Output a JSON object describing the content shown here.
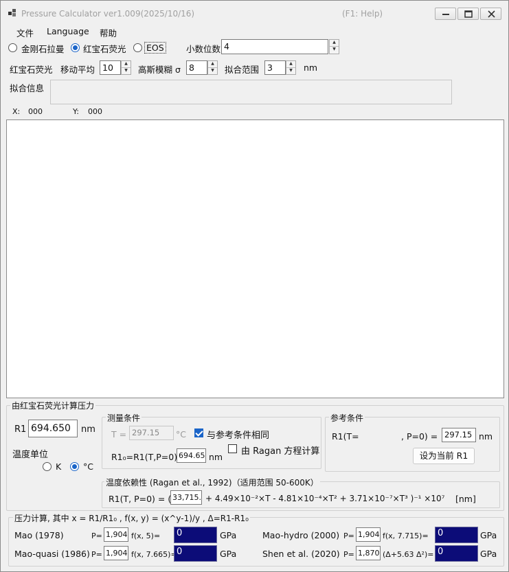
{
  "window": {
    "title": "Pressure Calculator  ver1.009(2025/10/16)",
    "help_hint": "(F1: Help)"
  },
  "menu": [
    "文件",
    "Language",
    "帮助"
  ],
  "mode": {
    "options": [
      "金刚石拉曼",
      "红宝石荧光",
      "EOS"
    ],
    "selected": "红宝石荧光",
    "decimals_label": "小数位数",
    "decimals_value": "4"
  },
  "fit": {
    "section_label": "红宝石荧光",
    "moving_avg_label": "移动平均",
    "moving_avg_value": "10",
    "gauss_label": "高斯模糊 σ",
    "gauss_value": "8",
    "range_label": "拟合范围",
    "range_value": "3",
    "range_unit": "nm",
    "info_label": "拟合信息",
    "info_value": ""
  },
  "cursor": {
    "x_label": "X:",
    "x_value": "000",
    "y_label": "Y:",
    "y_value": "000"
  },
  "ruby": {
    "group_title": "由红宝石荧光计算压力",
    "r1_label": "R1",
    "r1_value": "694.650",
    "r1_unit": "nm",
    "temp_unit_label": "温度单位",
    "temp_units": [
      "K",
      "°C"
    ],
    "temp_unit_selected": "°C",
    "measure": {
      "title": "测量条件",
      "t_label": "T =",
      "t_value": "297.15",
      "t_unit": "°C",
      "same_as_ref_label": "与参考条件相同",
      "same_as_ref_checked": true,
      "r10_label": "R1₀=R1(T,P=0)",
      "r10_value": "694.650",
      "r10_unit": "nm",
      "ragan_label": "由 Ragan 方程计算",
      "ragan_checked": false
    },
    "reference": {
      "title": "参考条件",
      "r1t_label": "R1(T=",
      "p0_label": ", P=0) =",
      "t_value": "297.15",
      "unit": "nm",
      "set_button": "设为当前 R1"
    },
    "temp_dep": {
      "title": "温度依赖性 (Ragan et al., 1992)（适用范围 50-600K）",
      "prefix": "R1(T, P=0) = (",
      "coef_value": "33,715.0",
      "formula_rest": "+ 4.49×10⁻²×T - 4.81×10⁻⁴×T² + 3.71×10⁻⁷×T³ )⁻¹ ×10⁷",
      "unit": "[nm]"
    },
    "pressure": {
      "title": "压力计算, 其中 x = R1/R1₀ ,  f(x, y) = (x^y-1)/y ,  Δ=R1-R1₀",
      "p_label": "P=",
      "unit": "GPa",
      "rows": [
        {
          "name": "Mao (1978)",
          "coef": "1,904",
          "func": "f(x, 5)=",
          "result": "0"
        },
        {
          "name": "Mao-hydro (2000)",
          "coef": "1,904",
          "func": "f(x, 7.715)=",
          "result": "0"
        },
        {
          "name": "Mao-quasi (1986)",
          "coef": "1,904",
          "func": "f(x, 7.665)=",
          "result": "0"
        },
        {
          "name": "Shen et al. (2020)",
          "coef": "1,870",
          "func": "(Δ+5.63 Δ²)=",
          "result": "0"
        }
      ]
    }
  },
  "colors": {
    "accent": "#1a64c8",
    "result_bg": "#0c0c78"
  }
}
